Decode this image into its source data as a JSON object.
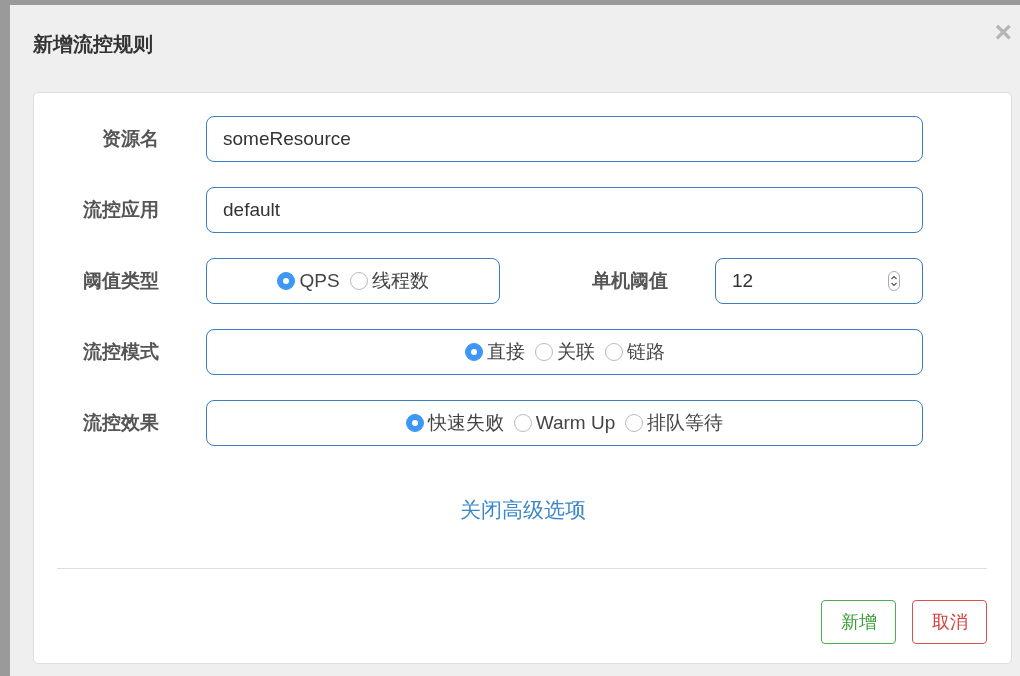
{
  "dialog": {
    "title": "新增流控规则",
    "close": "×"
  },
  "rows": [
    {
      "kind": "text",
      "label": "资源名",
      "value": "someResource"
    },
    {
      "kind": "text",
      "label": "流控应用",
      "value": "default"
    },
    {
      "kind": "radio",
      "label": "阈值类型",
      "options": [
        {
          "label": "QPS",
          "selected": true
        },
        {
          "label": "线程数",
          "selected": false
        }
      ],
      "side": {
        "label": "单机阈值",
        "value": "12"
      }
    },
    {
      "kind": "radio",
      "label": "流控模式",
      "options": [
        {
          "label": "直接",
          "selected": true
        },
        {
          "label": "关联",
          "selected": false
        },
        {
          "label": "链路",
          "selected": false
        }
      ]
    },
    {
      "kind": "radio",
      "label": "流控效果",
      "options": [
        {
          "label": "快速失败",
          "selected": true
        },
        {
          "label": "Warm Up",
          "selected": false
        },
        {
          "label": "排队等待",
          "selected": false
        }
      ]
    }
  ],
  "advanced_link": "关闭高级选项",
  "buttons": [
    {
      "label": "新增",
      "kind": "confirm"
    },
    {
      "label": "取消",
      "kind": "cancel"
    }
  ]
}
